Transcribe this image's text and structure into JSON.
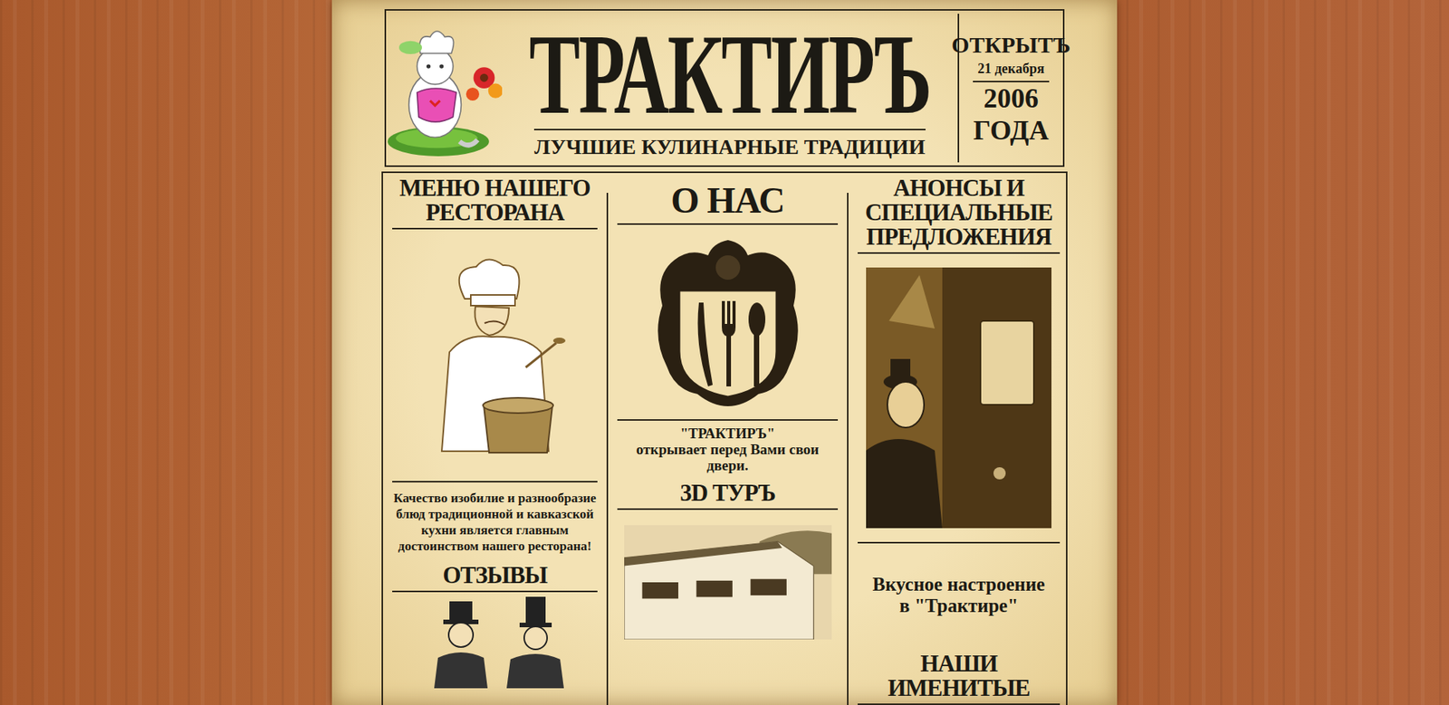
{
  "header": {
    "title": "ТРАКТИРЪ",
    "subtitle": "ЛУЧШИЕ КУЛИНАРНЫЕ ТРАДИЦИИ",
    "opened": {
      "label": "ОТКРЫТЪ",
      "date": "21 декабря",
      "year": "2006",
      "suffix": "ГОДА"
    }
  },
  "menu": {
    "title": "МЕНЮ НАШЕГО РЕСТОРАНА",
    "description": "Качество изобилие и разнообразие блюд традиционной и кавказской кухни является главным достоинством нашего ресторана!",
    "reviews_title": "ОТЗЫВЫ"
  },
  "about": {
    "title": "О НАС",
    "name": "\"ТРАКТИРЪ\"",
    "text": "открывает перед Вами свои двери.",
    "tour_title": "3D ТУРЪ"
  },
  "announcements": {
    "title": "АНОНСЫ И СПЕЦИАЛЬНЫЕ ПРЕДЛОЖЕНИЯ",
    "caption": "Вкусное настроение в \"Трактире\"",
    "next_title": "НАШИ ИМЕНИТЫЕ"
  }
}
